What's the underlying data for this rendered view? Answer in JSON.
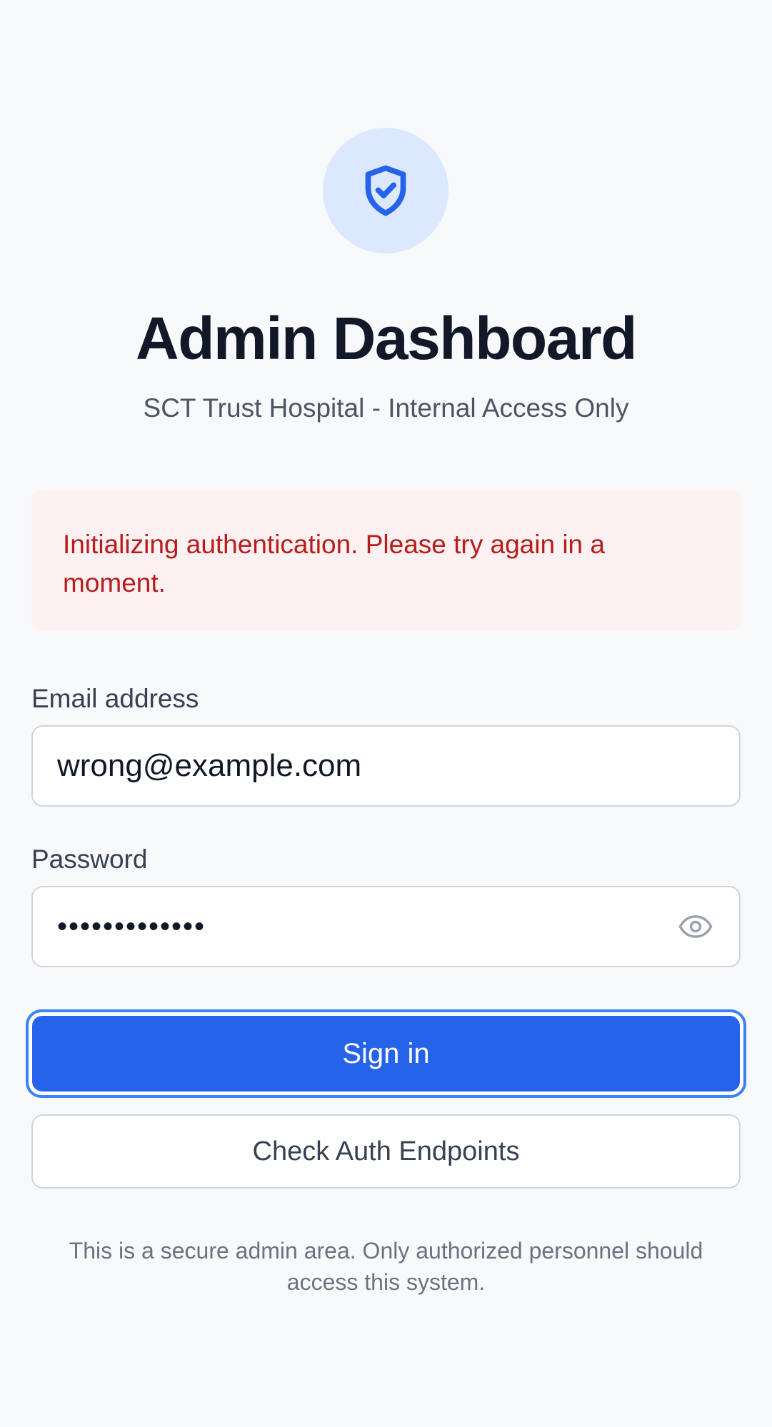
{
  "header": {
    "logo_icon": "shield-check-icon",
    "title": "Admin Dashboard",
    "subtitle": "SCT Trust Hospital - Internal Access Only"
  },
  "alert": {
    "message": "Initializing authentication. Please try again in a moment.",
    "type": "error"
  },
  "form": {
    "email_label": "Email address",
    "email_value": "wrong@example.com",
    "password_label": "Password",
    "password_masked": "•••••••••••••",
    "password_toggle_icon": "eye-icon",
    "signin_label": "Sign in",
    "check_label": "Check Auth Endpoints"
  },
  "footer": {
    "notice": "This is a secure admin area. Only authorized personnel should access this system."
  },
  "colors": {
    "primary": "#2563eb",
    "focus_ring": "#3b82f6",
    "alert_bg": "#fef1f1",
    "alert_text": "#b91c1c",
    "icon_bg": "#dbe8fe"
  }
}
